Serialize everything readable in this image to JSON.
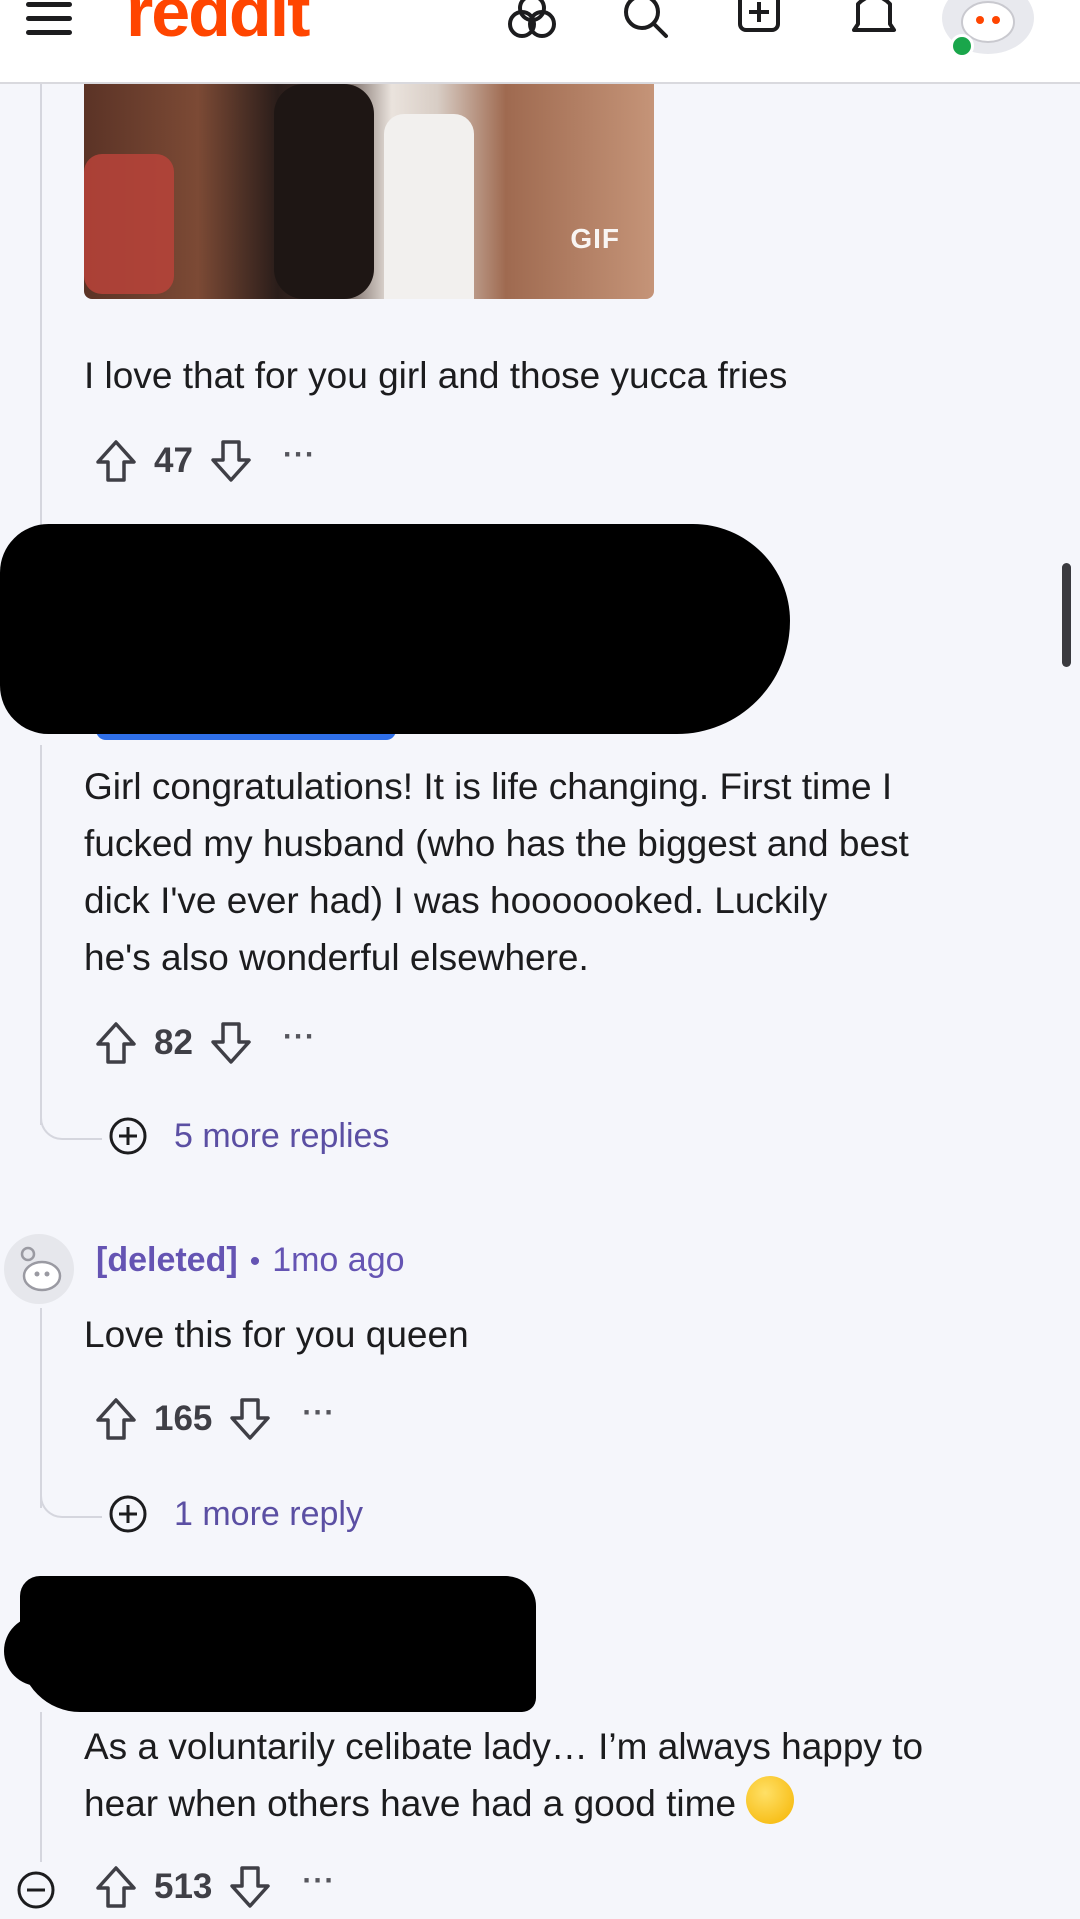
{
  "header": {
    "logo": "reddit",
    "icons": [
      "menu-icon",
      "communities-icon",
      "search-icon",
      "create-post-icon",
      "notifications-icon",
      "user-avatar"
    ]
  },
  "comments": [
    {
      "gif_label": "GIF",
      "body": "I love that for you girl and those yucca fries",
      "votes": "47",
      "more": "···"
    },
    {
      "body_lines": [
        "Girl congratulations! It is life changing. First time I",
        "fucked my husband (who has the biggest and best",
        "dick I've ever had) I was hooooooked. Luckily",
        "he's also wonderful elsewhere."
      ],
      "votes": "82",
      "more": "···",
      "more_replies": "5 more replies"
    },
    {
      "username": "[deleted]",
      "separator": "•",
      "time": "1mo ago",
      "body": "Love this for you queen",
      "votes": "165",
      "more": "···",
      "more_replies": "1 more reply"
    },
    {
      "body_lines": [
        "As a voluntarily celibate lady… I’m always happy to",
        "hear when others have had a good time"
      ],
      "emoji": "rolling-on-floor-laughing",
      "votes": "513",
      "more": "···"
    }
  ],
  "colors": {
    "brand": "#ff4500",
    "link": "#5b4fa3",
    "background": "#f5f6fb"
  }
}
